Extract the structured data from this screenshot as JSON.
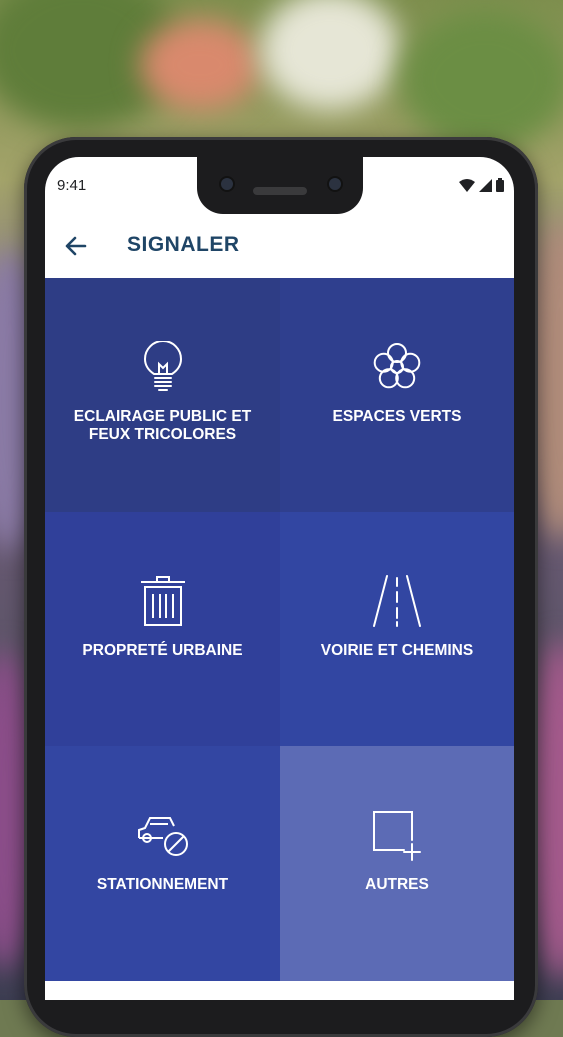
{
  "status_bar": {
    "time": "9:41"
  },
  "app_bar": {
    "title": "SIGNALER",
    "back_icon": "arrow-left-icon"
  },
  "tiles": [
    {
      "label": "ECLAIRAGE PUBLIC ET FEUX TRICOLORES",
      "icon": "lightbulb-icon",
      "color": "#2e3d85"
    },
    {
      "label": "ESPACES VERTS",
      "icon": "flower-icon",
      "color": "#2f3f8e"
    },
    {
      "label": "PROPRETÉ URBAINE",
      "icon": "trash-icon",
      "color": "#30409a"
    },
    {
      "label": "VOIRIE ET CHEMINS",
      "icon": "road-icon",
      "color": "#3246a2"
    },
    {
      "label": "STATIONNEMENT",
      "icon": "no-parking-car-icon",
      "color": "#3346a2"
    },
    {
      "label": "AUTRES",
      "icon": "add-square-icon",
      "color": "#5c6bb5"
    }
  ]
}
